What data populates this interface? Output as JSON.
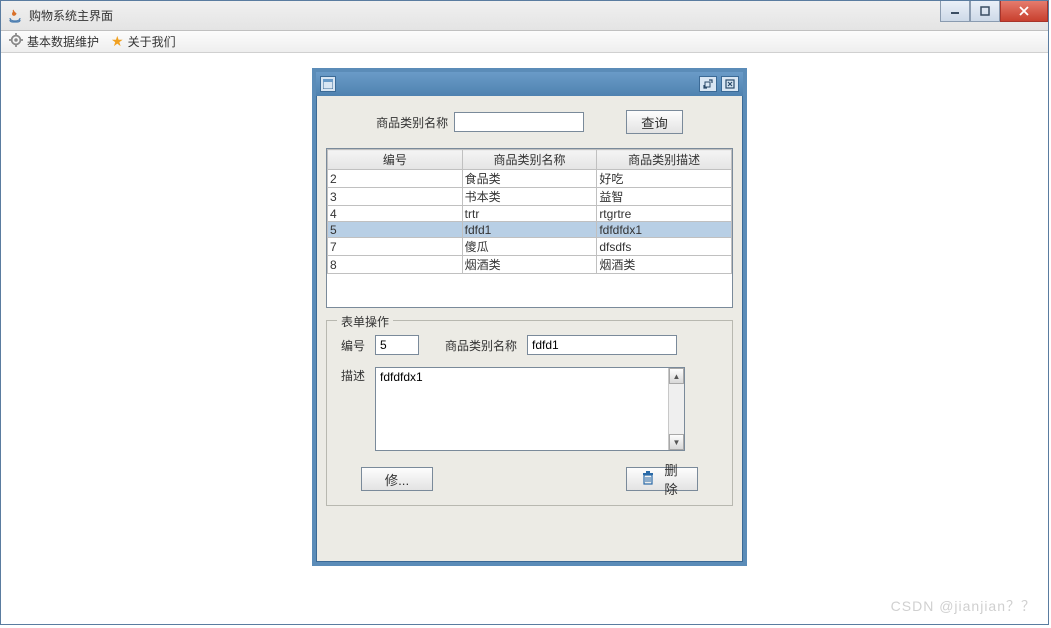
{
  "window": {
    "title": "购物系统主界面"
  },
  "menubar": {
    "data_maintain": "基本数据维护",
    "about_us": "关于我们"
  },
  "search": {
    "label": "商品类别名称",
    "value": "",
    "button": "查询"
  },
  "table": {
    "headers": [
      "编号",
      "商品类别名称",
      "商品类别描述"
    ],
    "rows": [
      {
        "id": "2",
        "name": "食品类",
        "desc": "好吃",
        "selected": false
      },
      {
        "id": "3",
        "name": "书本类",
        "desc": "益智",
        "selected": false
      },
      {
        "id": "4",
        "name": "trtr",
        "desc": "rtgrtre",
        "selected": false
      },
      {
        "id": "5",
        "name": "fdfd1",
        "desc": "fdfdfdx1",
        "selected": true
      },
      {
        "id": "7",
        "name": "傻瓜",
        "desc": "dfsdfs",
        "selected": false
      },
      {
        "id": "8",
        "name": "烟酒类",
        "desc": "烟酒类",
        "selected": false
      }
    ]
  },
  "form": {
    "legend": "表单操作",
    "id_label": "编号",
    "id_value": "5",
    "name_label": "商品类别名称",
    "name_value": "fdfd1",
    "desc_label": "描述",
    "desc_value": "fdfdfdx1",
    "modify_label": "修...",
    "delete_label": "删除"
  },
  "watermark": "CSDN @jianjian？？"
}
